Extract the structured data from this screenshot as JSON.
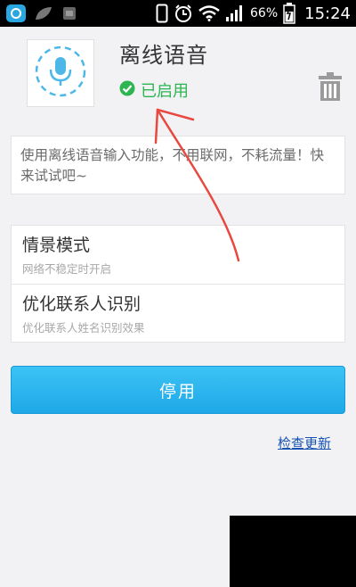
{
  "status_bar": {
    "battery_percent": "66%",
    "time": "15:24"
  },
  "app": {
    "title": "离线语音",
    "status": "已启用",
    "description": "使用离线语音输入功能，不用联网，不耗流量！快来试试吧~"
  },
  "settings": [
    {
      "title": "情景模式",
      "subtitle": "网络不稳定时开启"
    },
    {
      "title": "优化联系人识别",
      "subtitle": "优化联系人姓名识别效果"
    }
  ],
  "actions": {
    "disable_label": "停用",
    "check_update_label": "检查更新"
  },
  "icons": [
    "app-logo-icon",
    "sim-icon",
    "phone-icon",
    "alarm-icon",
    "wifi-icon",
    "signal-icon",
    "battery-icon",
    "microphone-icon",
    "check-circle-icon",
    "trash-icon"
  ],
  "colors": {
    "accent": "#1ea8e8",
    "enabled": "#2db552",
    "link": "#1552b3",
    "annotation": "#e8483f"
  }
}
